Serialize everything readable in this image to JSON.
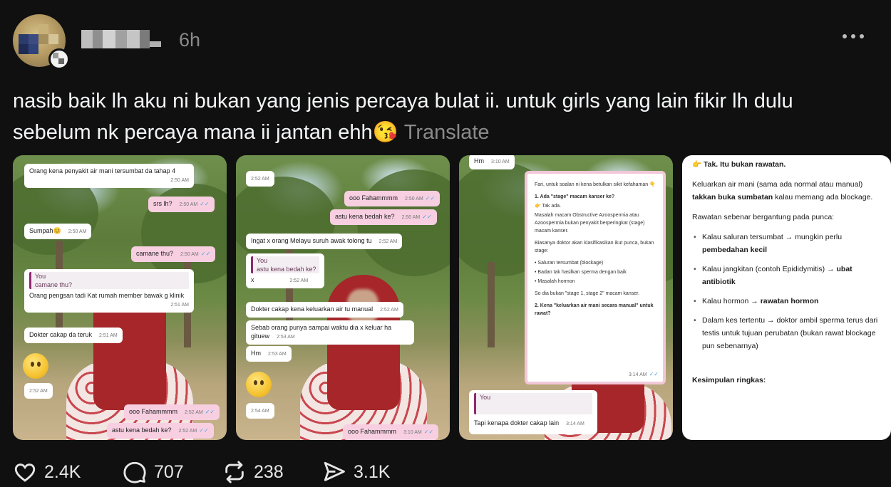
{
  "post": {
    "timestamp": "6h",
    "text": "nasib baik lh aku ni bukan yang jenis percaya bulat ii. untuk girls yang lain fikir lh dulu sebelum nk percaya mana ii jantan ehh😘",
    "translate_label": "Translate"
  },
  "media": {
    "card1": {
      "msgs": [
        {
          "text": "Orang kena penyakit air mani tersumbat da tahap 4",
          "time": "2:50 AM"
        },
        {
          "text": "srs lh?",
          "time": "2:50 AM"
        },
        {
          "text": "Sumpah😊",
          "time": "2:50 AM"
        },
        {
          "text": "camane thu?",
          "time": "2:50 AM"
        },
        {
          "quote_sender": "You",
          "quote_text": "camane thu?",
          "text": "Orang pengsan tadi Kat rumah member bawak g klinik",
          "time": "2:51 AM"
        },
        {
          "text": "Dokter cakap da teruk",
          "time": "2:51 AM"
        },
        {
          "time": "2:52 AM"
        },
        {
          "text": "ooo Fahammmm",
          "time": "2:52 AM"
        },
        {
          "text": "astu kena bedah ke?",
          "time": "2:52 AM"
        }
      ]
    },
    "card2": {
      "msgs": [
        {
          "time": "2:52 AM"
        },
        {
          "text": "ooo Fahammmm",
          "time": "2:50 AM"
        },
        {
          "text": "astu kena bedah ke?",
          "time": "2:50 AM"
        },
        {
          "text": "Ingat x orang Melayu suruh awak tolong tu",
          "time": "2:52 AM"
        },
        {
          "quote_sender": "You",
          "quote_text": "astu kena bedah ke?",
          "text": "x",
          "time": "2:52 AM"
        },
        {
          "text": "Dokter cakap kena keluarkan air tu manual",
          "time": "2:52 AM"
        },
        {
          "text": "Sebab orang punya sampai waktu dia x keluar ha gituew",
          "time": "2:53 AM"
        },
        {
          "text": "Hm",
          "time": "2:53 AM"
        },
        {
          "time": "2:54 AM"
        },
        {
          "text": "ooo Fahammmm",
          "time": "3:10 AM"
        }
      ]
    },
    "card3": {
      "top_msg": {
        "text": "Hm",
        "time": "3:10 AM"
      },
      "doc_lines": [
        "Fari, untuk soalan ni kena betulkan sikit kefahaman 👇",
        "1. Ada \"stage\" macam kanser ke?",
        "👉 Tak ada.",
        "Masalah macam Obstructive Azoospermia atau Azoospermia bukan penyakit berperingkat (stage) macam kanser.",
        "Biasanya doktor akan klasifikasikan ikut punca, bukan stage:",
        "• Saluran tersumbat (blockage)",
        "• Badan tak hasilkan sperma dengan baik",
        "• Masalah hormon",
        "So dia bukan \"stage 1, stage 2\" macam kanser.",
        "2. Kena \"keluarkan air mani secara manual\" untuk rawat?"
      ],
      "doc_time": "3:14 AM",
      "reply_sender": "You",
      "reply_text": "Tapi kenapa dokter cakap lain",
      "reply_time": "3:14 AM"
    },
    "card4": {
      "line1": "👉 Tak. Itu bukan rawatan.",
      "line2a": "Keluarkan air mani (sama ada normal atau manual)",
      "line2b": "takkan buka sumbatan",
      "line2c": " kalau memang ada blockage.",
      "line3": "Rawatan sebenar bergantung pada punca:",
      "items": [
        {
          "a": "Kalau saluran tersumbat → mungkin perlu ",
          "b": "pembedahan kecil"
        },
        {
          "a": "Kalau jangkitan (contoh Epididymitis) → ",
          "b": "ubat antibiotik"
        },
        {
          "a": "Kalau hormon → ",
          "b": "rawatan hormon"
        },
        {
          "a": "Dalam kes tertentu → doktor ambil sperma terus dari testis untuk tujuan perubatan (bukan rawat blockage pun sebenarnya)",
          "b": ""
        }
      ],
      "summary_title": "Kesimpulan ringkas:"
    }
  },
  "actions": {
    "likes": "2.4K",
    "comments": "707",
    "reposts": "238",
    "shares": "3.1K"
  },
  "colors": {
    "background": "#101010",
    "text": "#f3f5f7",
    "muted": "#8a8a8a"
  }
}
